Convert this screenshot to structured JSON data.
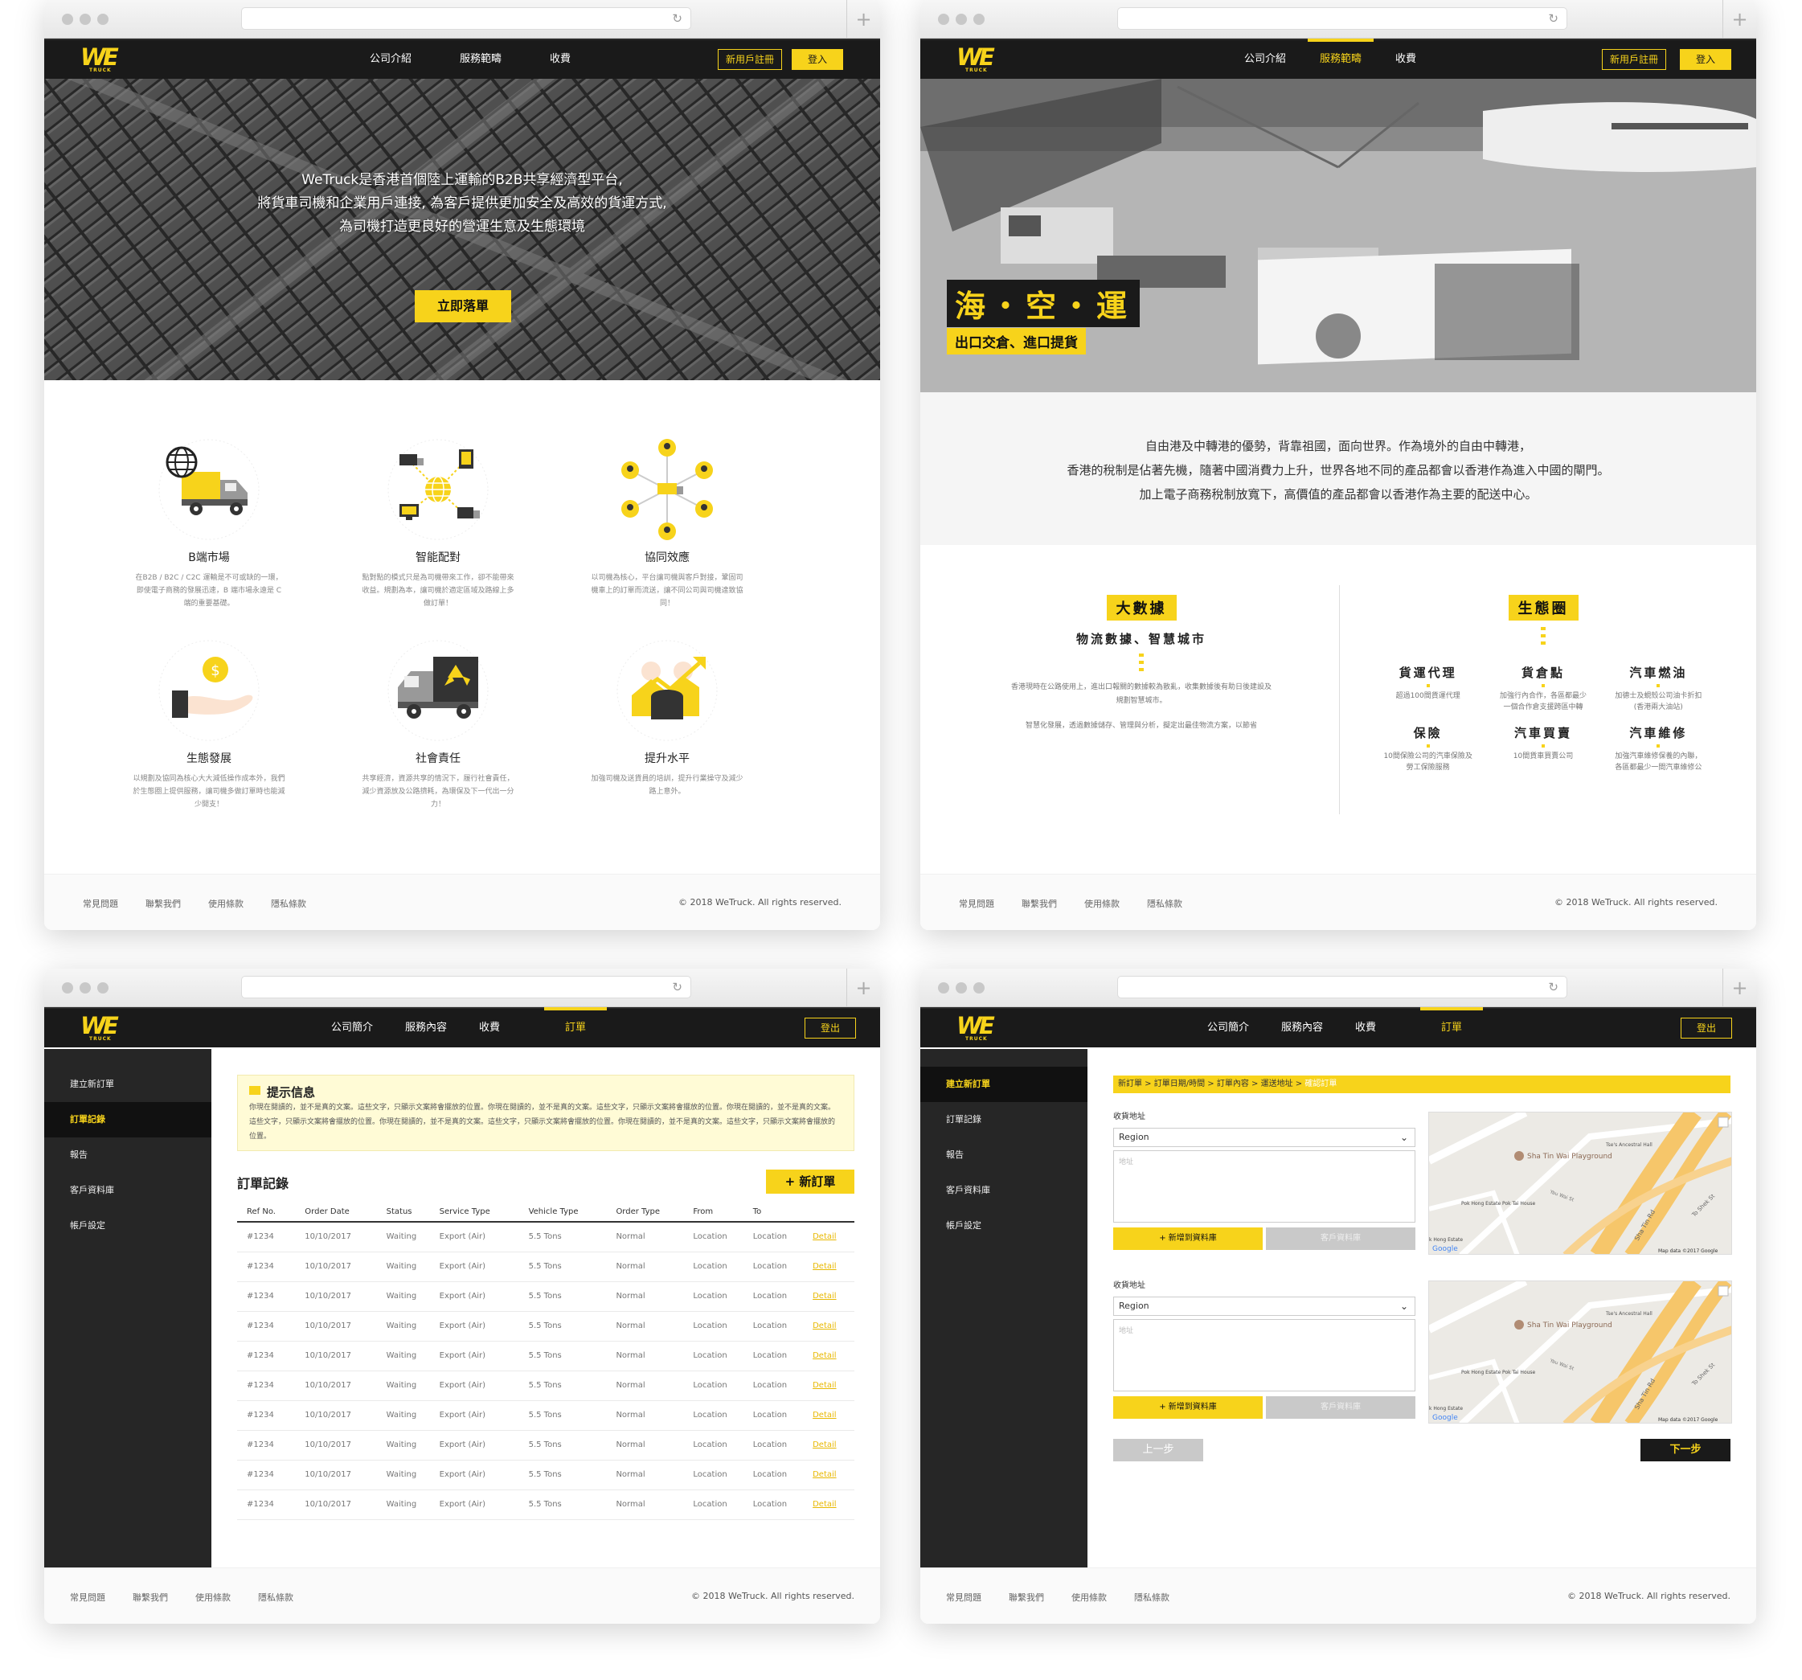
{
  "brand": {
    "logo_text": "WE",
    "logo_sub": "TRUCK",
    "accent": "#f7d31b",
    "dark": "#1a1a1a"
  },
  "public_nav": {
    "items": [
      "公司介紹",
      "服務範疇",
      "收費"
    ],
    "register": "新用戶註冊",
    "login": "登入"
  },
  "member_nav": {
    "items": [
      "公司簡介",
      "服務內容",
      "收費",
      "訂單"
    ],
    "logout": "登出"
  },
  "footer": {
    "links": [
      "常見問題",
      "聯繫我們",
      "使用條款",
      "隱私條款"
    ],
    "copyright": "© 2018 WeTruck. All rights reserved."
  },
  "home": {
    "hero_lines": [
      "WeTruck是香港首個陸上運輸的B2B共享經濟型平台,",
      "將貨車司機和企業用戶連接, 為客戶提供更加安全及高效的貨運方式,",
      "為司機打造更良好的營運生意及生態環境"
    ],
    "cta": "立即落單",
    "features": [
      {
        "title": "B端市場",
        "icon": "globe-truck-icon",
        "desc": "在B2B / B2C / C2C 運輸是不可或缺的一環，即使電子商務的發展迅速，B 端市場永遠是 C 端的重要基礎。"
      },
      {
        "title": "智能配對",
        "icon": "network-icon",
        "desc": "點對點的模式只是為司機帶來工作，卻不能帶來收益。規劃為本，讓司機於適定區域及路線上多做訂單！"
      },
      {
        "title": "協同效應",
        "icon": "people-network-icon",
        "desc": "以司機為核心，平台讓司機與客戶對接，鞏固司機車上的訂單而流送，讓不同公司與司機達致協同！"
      },
      {
        "title": "生態發展",
        "icon": "coin-hand-icon",
        "desc": "以規劃及協同為核心大大減低操作成本外，我們於生態圈上提供服務，讓司機多做訂單時也能減少開支！"
      },
      {
        "title": "社會責任",
        "icon": "recycle-truck-icon",
        "desc": "共享經濟，資源共享的情況下，履行社會責任，減少資源放及公路擠耗，為環保及下一代出一分力！"
      },
      {
        "title": "提升水平",
        "icon": "growth-icon",
        "desc": "加強司機及送貨員的培訓，提升行業操守及減少路上意外。"
      }
    ]
  },
  "services": {
    "hero_title": "海・空・運",
    "hero_sub": "出口交倉、進口提貨",
    "intro": [
      "自由港及中轉港的優勢，背靠祖國，面向世界。作為境外的自由中轉港，",
      "香港的稅制是佔著先機，隨著中國消費力上升，世界各地不同的產品都會以香港作為進入中國的閘門。",
      "加上電子商務稅制放寬下，高價值的產品都會以香港作為主要的配送中心。"
    ],
    "bigdata": {
      "tag": "大數據",
      "subtitle": "物流數據、智慧城市",
      "p1": "香港現時在公路使用上，進出口報關的數據較為散亂，收集數據後有助日後建設及規劃智慧城市。",
      "p2": "智慧化發展，透過數據儲存、管理與分析，擬定出最佳物流方案，以節省"
    },
    "eco": {
      "tag": "生態圈",
      "items": [
        {
          "title": "貨運代理",
          "desc": "超過100間貨運代理"
        },
        {
          "title": "貨倉點",
          "desc": "加強行內合作，各區都最少一個合作倉支援跨區中轉"
        },
        {
          "title": "汽車燃油",
          "desc": "加德士及蜆殼公司油卡折扣 (香港兩大油站)"
        },
        {
          "title": "保險",
          "desc": "10間保險公司的汽車保險及勞工保險服務"
        },
        {
          "title": "汽車買賣",
          "desc": "10間貨車買賣公司"
        },
        {
          "title": "汽車維修",
          "desc": "加強汽車維修保養的內聯，各區都最少一間汽車維修公"
        }
      ]
    }
  },
  "orders": {
    "sidebar": [
      "建立新訂單",
      "訂單記錄",
      "報告",
      "客戶資料庫",
      "帳戶設定"
    ],
    "notice_title": "提示信息",
    "notice_text": "你現在閱讀的，並不是真的文案。這些文字，只顯示文案將會擺放的位置。你現在閱讀的，並不是真的文案。這些文字，只顯示文案將會擺放的位置。你現在閱讀的，並不是真的文案。這些文字，只顯示文案將會擺放的位置。你現在閱讀的，並不是真的文案。這些文字，只顯示文案將會擺放的位置。你現在閱讀的，並不是真的文案。這些文字，只顯示文案將會擺放的位置。",
    "title": "訂單記錄",
    "new_order": "+ 新訂單",
    "columns": [
      "Ref No.",
      "Order Date",
      "Status",
      "Service Type",
      "Vehicle Type",
      "Order Type",
      "From",
      "To",
      ""
    ],
    "row": {
      "ref": "#1234",
      "date": "10/10/2017",
      "status": "Waiting",
      "service": "Export (Air)",
      "vehicle": "5.5 Tons",
      "type": "Normal",
      "from": "Location",
      "to": "Location",
      "action": "Detail"
    },
    "row_count": 10
  },
  "new_order": {
    "breadcrumb": [
      "新訂單",
      "訂單日期/時間",
      "訂單內容",
      "運送地址",
      "確認訂單"
    ],
    "sections": [
      {
        "label": "收貨地址",
        "region": "Region",
        "addr_placeholder": "地址",
        "add_db": "+ 新增到資料庫",
        "client_db": "客戶資料庫"
      },
      {
        "label": "收貨地址",
        "region": "Region",
        "addr_placeholder": "地址",
        "add_db": "+ 新增到資料庫",
        "client_db": "客戶資料庫"
      }
    ],
    "map_labels": {
      "playground": "Sha Tin Wai Playground",
      "hall": "Tse's Ancestral Hall",
      "estate": "Pok Hong Estate Pok Tai House",
      "road1": "Sha Tin Rd",
      "road2": "To Shek St",
      "road3": "Yau Wai St",
      "data": "Map data ©2017 Google",
      "google": "Google",
      "estate2": "k Hong Estate"
    },
    "prev": "上一步",
    "next": "下一步"
  }
}
